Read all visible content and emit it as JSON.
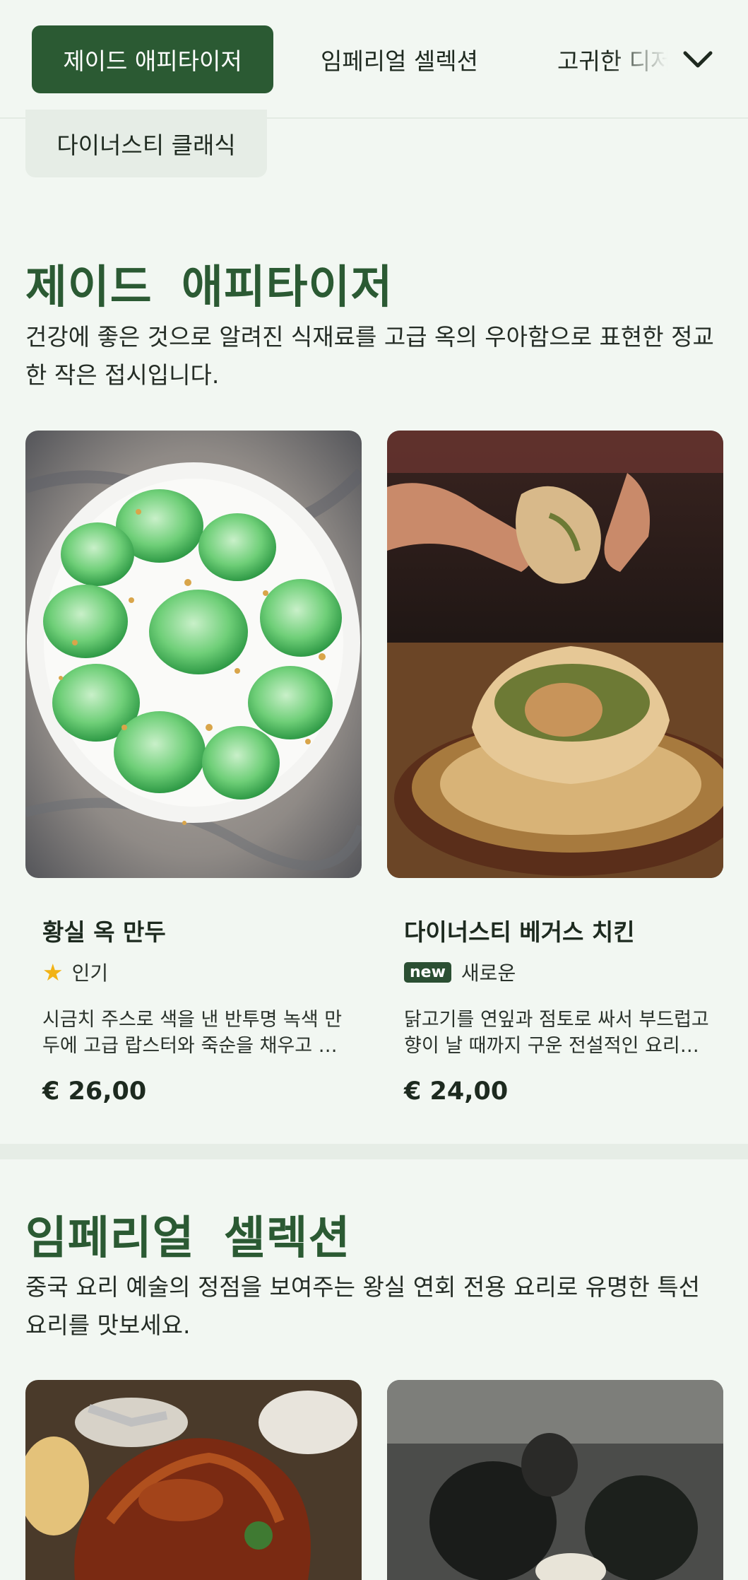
{
  "nav": {
    "tabs": [
      {
        "label": "제이드 애피타이저",
        "active": true
      },
      {
        "label": "임페리얼 셀렉션",
        "active": false
      },
      {
        "label": "고귀한 디저트",
        "active": false
      },
      {
        "label": "다이너스티 클래식",
        "active": false
      }
    ],
    "expand_icon": "chevron-down-icon"
  },
  "sections": [
    {
      "title": "제이드 애피타이저",
      "description": "건강에 좋은 것으로 알려진 식재료를 고급 옥의 우아함으로 표현한 정교한 작은 접시입니다.",
      "items": [
        {
          "name": "황실 옥 만두",
          "badge_icon": "star-icon",
          "badge_text": "인기",
          "description": "시금치 주스로 색을 낸 반투명 녹색 만두에 고급 랍스터와 죽순을 채우고 금박을 뿌려 완성했습니다.",
          "price": "€ 26,00"
        },
        {
          "name": "다이너스티 베거스 치킨",
          "badge_label": "new",
          "badge_text": "새로운",
          "description": "닭고기를 연잎과 점토로 싸서 부드럽고 향이 날 때까지 구운 전설적인 요리입니다.",
          "price": "€ 24,00"
        }
      ]
    },
    {
      "title": "임페리얼 셀렉션",
      "description": "중국 요리 예술의 정점을 보여주는 왕실 연회 전용 요리로 유명한 특선 요리를 맛보세요."
    }
  ],
  "colors": {
    "accent": "#2b5a33",
    "background": "#f2f7f2",
    "star": "#f2b316"
  }
}
